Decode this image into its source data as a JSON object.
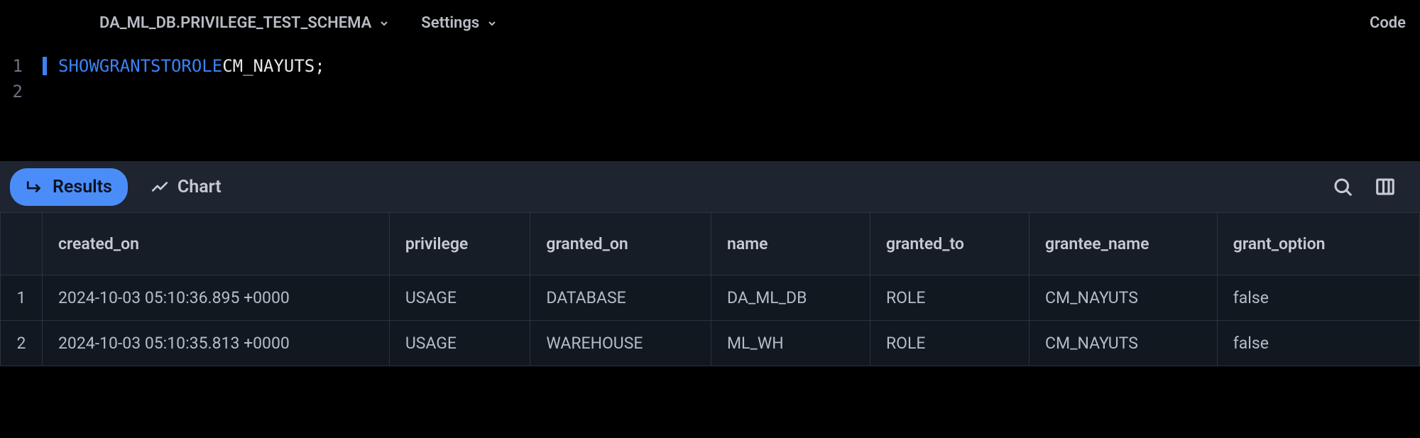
{
  "header": {
    "context": "DA_ML_DB.PRIVILEGE_TEST_SCHEMA",
    "settings": "Settings",
    "code": "Code"
  },
  "editor": {
    "lines": [
      {
        "num": "1",
        "tokens": [
          {
            "t": "SHOW ",
            "c": "kw"
          },
          {
            "t": "GRANTS ",
            "c": "kw"
          },
          {
            "t": "TO ",
            "c": "kw"
          },
          {
            "t": "ROLE ",
            "c": "kw"
          },
          {
            "t": "CM_NAYUTS",
            "c": "ident"
          },
          {
            "t": ";",
            "c": "punct"
          }
        ]
      },
      {
        "num": "2",
        "tokens": []
      }
    ]
  },
  "tabs": {
    "results": "Results",
    "chart": "Chart"
  },
  "table": {
    "columns": [
      "created_on",
      "privilege",
      "granted_on",
      "name",
      "granted_to",
      "grantee_name",
      "grant_option"
    ],
    "rows": [
      {
        "num": "1",
        "cells": [
          "2024-10-03 05:10:36.895 +0000",
          "USAGE",
          "DATABASE",
          "DA_ML_DB",
          "ROLE",
          "CM_NAYUTS",
          "false"
        ]
      },
      {
        "num": "2",
        "cells": [
          "2024-10-03 05:10:35.813 +0000",
          "USAGE",
          "WAREHOUSE",
          "ML_WH",
          "ROLE",
          "CM_NAYUTS",
          "false"
        ]
      }
    ]
  }
}
